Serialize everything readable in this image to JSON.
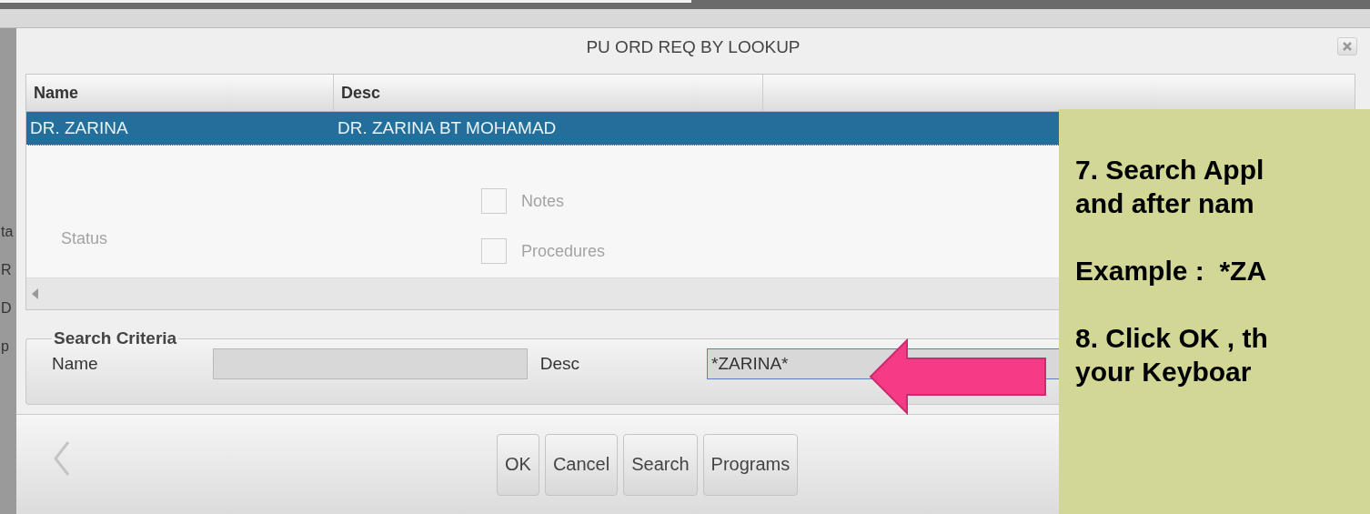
{
  "background_labels": [
    "ta",
    "R",
    "D",
    "p"
  ],
  "ghost_labels": [
    {
      "text": "Status",
      "kind": "label"
    },
    {
      "text": "Notes",
      "kind": "checkbox",
      "checked": false
    },
    {
      "text": "Procedures",
      "kind": "checkbox",
      "checked": false
    }
  ],
  "dialog": {
    "title": "PU ORD REQ BY LOOKUP"
  },
  "grid": {
    "columns": [
      "Name",
      "Desc"
    ],
    "rows": [
      {
        "cells": [
          "DR. ZARINA",
          "DR. ZARINA BT MOHAMAD"
        ],
        "selected": true
      }
    ]
  },
  "search_criteria": {
    "legend": "Search Criteria",
    "fields": [
      {
        "label": "Name"
      },
      {
        "label": "Desc",
        "value": "*ZARINA*"
      }
    ]
  },
  "buttons": [
    "OK",
    "Cancel",
    "Search",
    "Programs"
  ],
  "callout": {
    "paragraphs": [
      [
        "7. Search Appl",
        "and after nam"
      ],
      [
        "Example :  *ZA"
      ],
      [
        "8. Click OK , th",
        "your Keyboar"
      ]
    ]
  }
}
